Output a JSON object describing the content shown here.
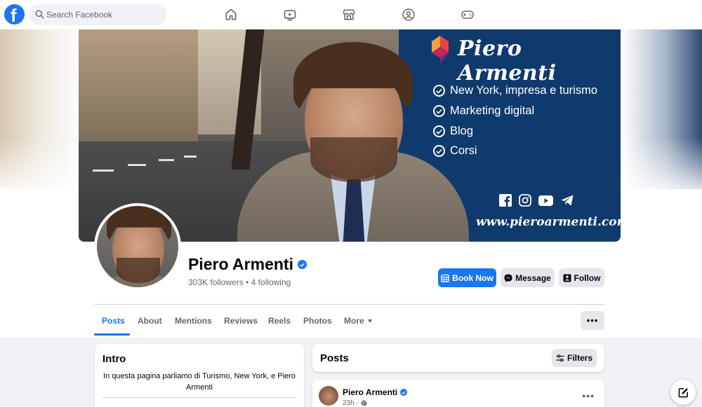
{
  "search": {
    "placeholder": "Search Facebook"
  },
  "nav": {
    "items": [
      "home-icon",
      "watch-icon",
      "marketplace-icon",
      "groups-icon",
      "gaming-icon"
    ]
  },
  "cover": {
    "brand": "Piero Armenti",
    "bullets": [
      "New York, impresa e turismo",
      "Marketing digital",
      "Blog",
      "Corsi"
    ],
    "social_icons": [
      "facebook-icon",
      "instagram-icon",
      "youtube-icon",
      "telegram-icon"
    ],
    "url": "www.pieroarmenti.com",
    "brand_color": "#0f3a6d"
  },
  "profile": {
    "name": "Piero Armenti",
    "followers": "303K followers",
    "separator": " • ",
    "following": "4 following",
    "verified": true
  },
  "actions": {
    "book_now": "Book Now",
    "message": "Message",
    "follow": "Follow",
    "more_dots": "•••"
  },
  "tabs": [
    {
      "label": "Posts",
      "active": true
    },
    {
      "label": "About"
    },
    {
      "label": "Mentions"
    },
    {
      "label": "Reviews"
    },
    {
      "label": "Reels"
    },
    {
      "label": "Photos"
    },
    {
      "label": "More"
    }
  ],
  "intro": {
    "title": "Intro",
    "text": "In questa pagina parliamo di Turismo, New York, e Piero Armenti"
  },
  "posts": {
    "title": "Posts",
    "filters_label": "Filters",
    "items": [
      {
        "author": "Piero Armenti",
        "time": "23h",
        "privacy_icon": "globe-icon",
        "dots": "•••"
      }
    ]
  },
  "colors": {
    "accent": "#1877f2",
    "page_bg": "#f0f2f5",
    "button_gray": "#e4e6eb"
  }
}
